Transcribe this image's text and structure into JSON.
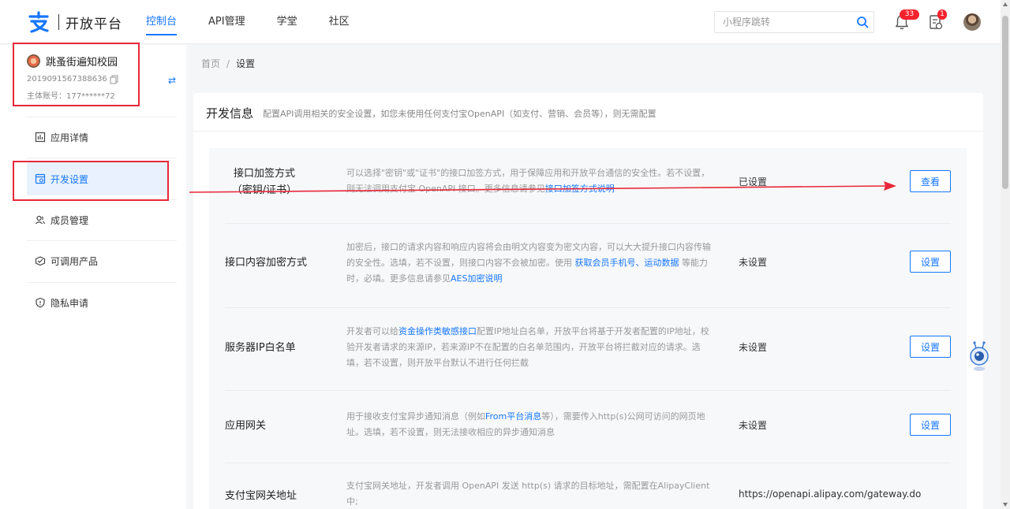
{
  "topbar": {
    "logo_text": "开放平台",
    "nav": [
      {
        "label": "控制台",
        "active": true
      },
      {
        "label": "API管理"
      },
      {
        "label": "学堂"
      },
      {
        "label": "社区"
      }
    ],
    "search_placeholder": "小程序跳转",
    "notification_count": "33",
    "task_count": "1"
  },
  "sidebar": {
    "app_name": "跳蚤街遍知校园",
    "app_id": "2019091567388636",
    "owner": "主体账号：177******72",
    "menu": [
      {
        "label": "应用详情",
        "icon": "chart-icon"
      },
      {
        "label": "开发设置",
        "icon": "code-settings-icon",
        "active": true
      },
      {
        "label": "成员管理",
        "icon": "members-icon"
      },
      {
        "label": "可调用产品",
        "icon": "products-icon"
      },
      {
        "label": "隐私申请",
        "icon": "shield-icon"
      }
    ]
  },
  "breadcrumb": {
    "home": "首页",
    "separator": "/",
    "current": "设置"
  },
  "panel": {
    "title": "开发信息",
    "description": "配置API调用相关的安全设置，如您未使用任何支付宝OpenAPI（如支付、营销、会员等），则无需配置",
    "rows": [
      {
        "label_line1": "接口加签方式",
        "label_line2": "（密钥/证书）",
        "desc_text": "可以选择\"密钥\"或\"证书\"的接口加签方式，用于保障应用和开放平台通信的安全性。若不设置，则无法调用支付宝 OpenAPI 接口。更多信息请参见",
        "desc_link": "接口加签方式说明",
        "status": "已设置",
        "button": "查看"
      },
      {
        "label_line1": "接口内容加密方式",
        "desc_text": "加密后，接口的请求内容和响应内容将会由明文内容变为密文内容，可以大大提升接口内容传输的安全性。选填，若不设置，则接口内容不会被加密。使用",
        "desc_link": "获取会员手机号",
        "desc_mid": "、",
        "desc_link2": "运动数据",
        "desc_tail": "等能力时，必填。更多信息请参见",
        "desc_link3": "AES加密说明",
        "status": "未设置",
        "button": "设置"
      },
      {
        "label_line1": "服务器IP白名单",
        "desc_pre": "开发者可以给",
        "desc_link": "资金操作类敏感接口",
        "desc_text": "配置IP地址白名单，开放平台将基于开发者配置的IP地址，校验开发者请求的来源IP，若来源IP不在配置的白名单范围内，开放平台将拦截对应的请求。选填，若不设置，则开放平台默认不进行任何拦截",
        "status": "未设置",
        "button": "设置"
      },
      {
        "label_line1": "应用网关",
        "desc_pre": "用于接收支付宝异步通知消息（例如",
        "desc_link": "From平台消息",
        "desc_text": "等），需要传入http(s)公网可访问的网页地址。选填，若不设置，则无法接收相应的异步通知消息",
        "status": "未设置",
        "button": "设置"
      },
      {
        "label_line1": "支付宝网关地址",
        "desc_text": "支付宝网关地址，开发者调用 OpenAPI 发送 http(s) 请求的目标地址，需配置在AlipayClient中;",
        "status": "https://openapi.alipay.com/gateway.do"
      }
    ]
  },
  "colors": {
    "primary": "#1677ff",
    "annotation_red": "#e8283a",
    "badge_red": "#f5222d"
  }
}
